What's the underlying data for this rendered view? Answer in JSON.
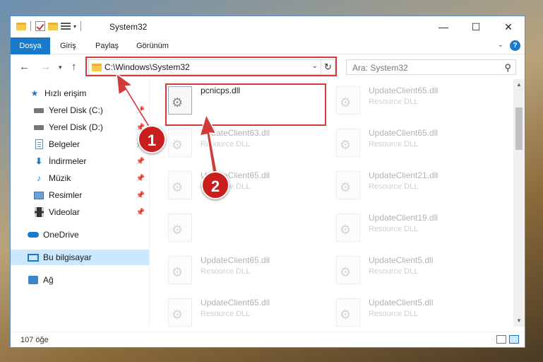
{
  "window": {
    "title": "System32",
    "controls": {
      "minimize": "—",
      "maximize": "☐",
      "close": "✕"
    }
  },
  "ribbon": {
    "tabs": [
      "Dosya",
      "Giriş",
      "Paylaş",
      "Görünüm"
    ],
    "expand_label": "⌄",
    "help_label": "?"
  },
  "address": {
    "path": "C:\\Windows\\System32",
    "search_placeholder": "Ara: System32"
  },
  "nav": {
    "items": [
      {
        "label": "Hızlı erişim",
        "icon": "star-icon"
      },
      {
        "label": "Yerel Disk (C:)",
        "icon": "drive-icon"
      },
      {
        "label": "Yerel Disk (D:)",
        "icon": "drive-icon"
      },
      {
        "label": "Belgeler",
        "icon": "document-icon"
      },
      {
        "label": "İndirmeler",
        "icon": "download-icon"
      },
      {
        "label": "Müzik",
        "icon": "music-icon"
      },
      {
        "label": "Resimler",
        "icon": "pictures-icon"
      },
      {
        "label": "Videolar",
        "icon": "video-icon"
      },
      {
        "label": "OneDrive",
        "icon": "cloud-icon"
      },
      {
        "label": "Bu bilgisayar",
        "icon": "computer-icon"
      },
      {
        "label": "Ağ",
        "icon": "network-icon"
      }
    ]
  },
  "files": [
    {
      "name": "pcnicps.dll",
      "desc": ""
    },
    {
      "name": "UpdateClient65.dll",
      "desc": "Resource DLL"
    },
    {
      "name": "UpdateClient63.dll",
      "desc": "Resource DLL"
    },
    {
      "name": "UpdateClient65.dll",
      "desc": "Resource DLL"
    },
    {
      "name": "UpdateClient65.dll",
      "desc": "Resource DLL"
    },
    {
      "name": "UpdateClient21.dll",
      "desc": "Resource DLL"
    },
    {
      "name": "",
      "desc": ""
    },
    {
      "name": "UpdateClient19.dll",
      "desc": "Resource DLL"
    },
    {
      "name": "UpdateClient65.dll",
      "desc": "Resource DLL"
    },
    {
      "name": "UpdateClient5.dll",
      "desc": "Resource DLL"
    },
    {
      "name": "UpdateClient65.dll",
      "desc": "Resource DLL"
    },
    {
      "name": "UpdateClient5.dll",
      "desc": "Resource DLL"
    }
  ],
  "status": {
    "count": "107 öğe"
  },
  "annotations": {
    "callout1": "1",
    "callout2": "2",
    "highlight_color": "#d23a3a"
  }
}
